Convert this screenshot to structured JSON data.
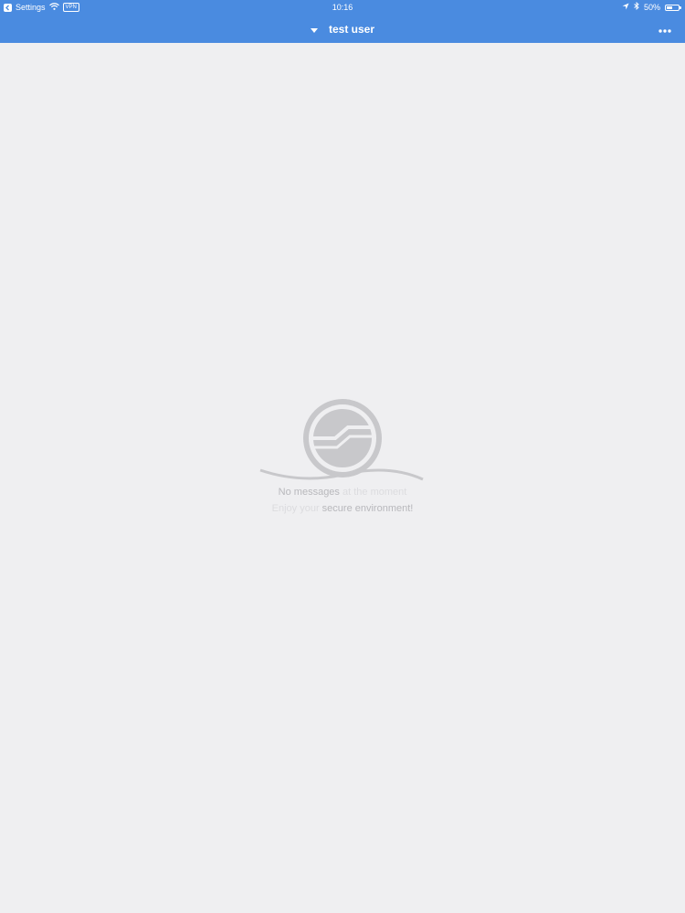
{
  "status_bar": {
    "back_label": "Settings",
    "vpn_label": "VPN",
    "time": "10:16",
    "battery_text": "50%",
    "battery_level": 0.5
  },
  "nav": {
    "title": "test user"
  },
  "empty_state": {
    "line1_part1": "No messages",
    "line1_part2": " at the moment",
    "line2_part1": "Enjoy your",
    "line2_part2": " secure environment!"
  },
  "colors": {
    "header": "#4a8be0",
    "background": "#efeff1",
    "logo": "#c8c8cb"
  }
}
